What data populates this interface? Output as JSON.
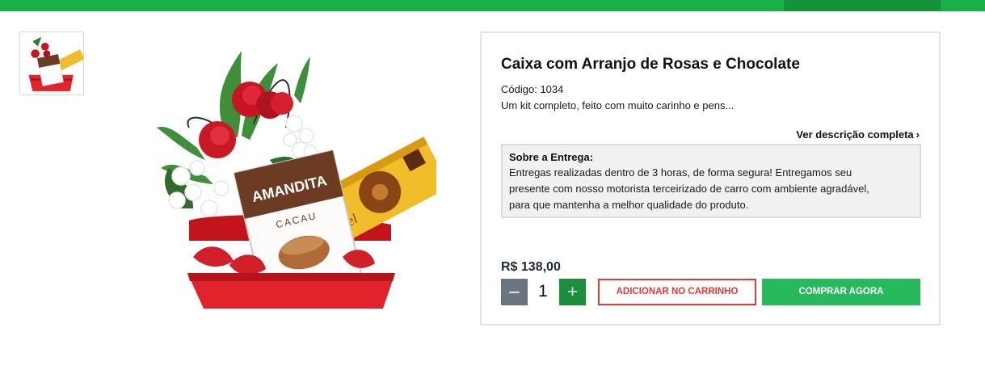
{
  "colors": {
    "top_bar": "#19b04a",
    "top_bar_dark": "#149439",
    "add_to_cart": "#e03a3a",
    "buy_now": "#27ba5c",
    "qty_minus": "#6b7582",
    "qty_plus": "#1d8f3c"
  },
  "gallery": {
    "thumbnails": [
      "product-thumbnail"
    ]
  },
  "product": {
    "title": "Caixa com Arranjo de Rosas e Chocolate",
    "code_label": "Código:",
    "code_value": "1034",
    "short_description": "Um kit completo, feito com muito carinho e pens...",
    "more_link": "Ver descrição completa",
    "more_link_icon": "chevron-right-icon",
    "image_texts": {
      "brand": "AMANDITA",
      "flavor": "CACAU",
      "box_text": "Mel"
    }
  },
  "delivery": {
    "title": "Sobre a Entrega:",
    "lines": [
      "Entregas realizadas dentro de 3 horas, de forma segura! Entregamos seu",
      "presente com nosso motorista terceirizado de carro com ambiente agradável,",
      "para que mantenha a melhor qualidade do produto."
    ]
  },
  "purchase": {
    "price": "R$ 138,00",
    "quantity": "1",
    "minus_label": "−",
    "plus_label": "+",
    "add_to_cart_label": "ADICIONAR NO CARRINHO",
    "buy_now_label": "COMPRAR AGORA"
  }
}
